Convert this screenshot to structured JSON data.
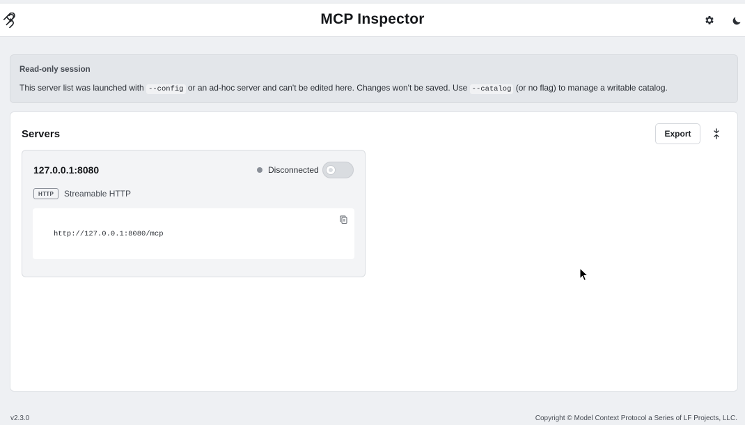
{
  "header": {
    "title": "MCP Inspector",
    "logo_icon": "mcp-logo-icon",
    "settings_icon": "gear-icon",
    "theme_icon": "moon-icon"
  },
  "notice": {
    "title": "Read-only session",
    "text_part1": "This server list was launched with ",
    "code1": "--config",
    "text_part2": " or an ad-hoc server and can't be edited here. Changes won't be saved. Use ",
    "code2": "--catalog",
    "text_part3": " (or no flag) to manage a writable catalog."
  },
  "servers_panel": {
    "title": "Servers",
    "export_label": "Export",
    "collapse_icon": "collapse-vertical-icon",
    "servers": [
      {
        "name": "127.0.0.1:8080",
        "status": "Disconnected",
        "status_color": "#8a8f98",
        "connected": false,
        "transport_badge": "HTTP",
        "transport_label": "Streamable HTTP",
        "url": "http://127.0.0.1:8080/mcp",
        "copy_icon": "copy-icon"
      }
    ]
  },
  "footer": {
    "version": "v2.3.0",
    "copyright": "Copyright © Model Context Protocol a Series of LF Projects, LLC."
  }
}
